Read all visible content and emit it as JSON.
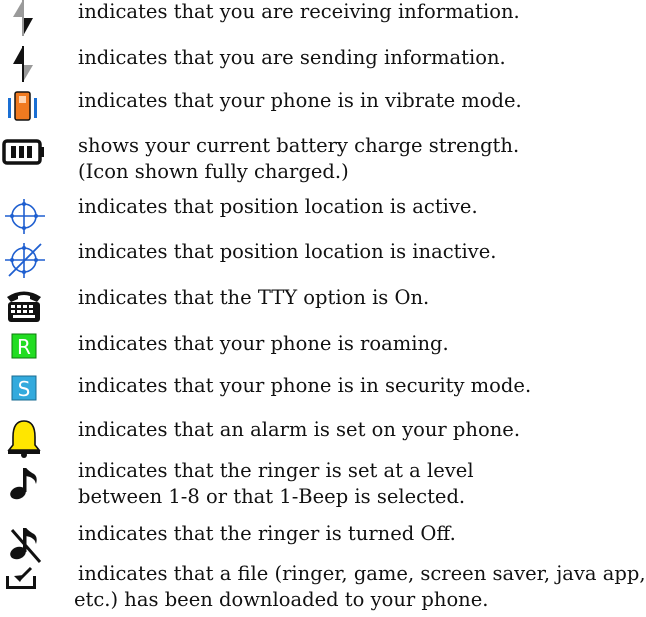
{
  "legend": {
    "items": [
      {
        "icon": "receiving-data-arrows-icon",
        "lines": [
          "indicates that you are receiving information."
        ]
      },
      {
        "icon": "sending-data-arrows-icon",
        "lines": [
          "indicates that you are sending information."
        ]
      },
      {
        "icon": "vibrate-mode-icon",
        "lines": [
          "indicates that your phone is in vibrate mode."
        ]
      },
      {
        "icon": "battery-full-icon",
        "lines": [
          "shows your current battery charge strength.",
          "(Icon shown fully charged.)"
        ]
      },
      {
        "icon": "location-on-icon",
        "lines": [
          "indicates that position location is active."
        ]
      },
      {
        "icon": "location-off-icon",
        "lines": [
          "indicates that position location is inactive."
        ]
      },
      {
        "icon": "tty-phone-icon",
        "lines": [
          "indicates that the TTY option is On."
        ]
      },
      {
        "icon": "roaming-icon",
        "glyph": "R",
        "color": "#22dd22",
        "lines": [
          "indicates that your phone is roaming."
        ]
      },
      {
        "icon": "security-mode-icon",
        "glyph": "S",
        "color": "#33aadd",
        "lines": [
          "indicates that your phone is in security mode."
        ]
      },
      {
        "icon": "alarm-bell-icon",
        "color": "#ffe600",
        "lines": [
          "indicates that an alarm is set on your phone."
        ]
      },
      {
        "icon": "ringer-on-icon",
        "lines": [
          "indicates that the ringer is set at a level",
          "between 1-8 or that 1-Beep is selected."
        ]
      },
      {
        "icon": "ringer-off-icon",
        "lines": [
          "indicates that the ringer is turned Off."
        ]
      },
      {
        "icon": "download-complete-icon",
        "lines": [
          "indicates that a file (ringer, game, screen saver, java app,",
          "etc.) has been downloaded to your phone."
        ]
      }
    ]
  }
}
